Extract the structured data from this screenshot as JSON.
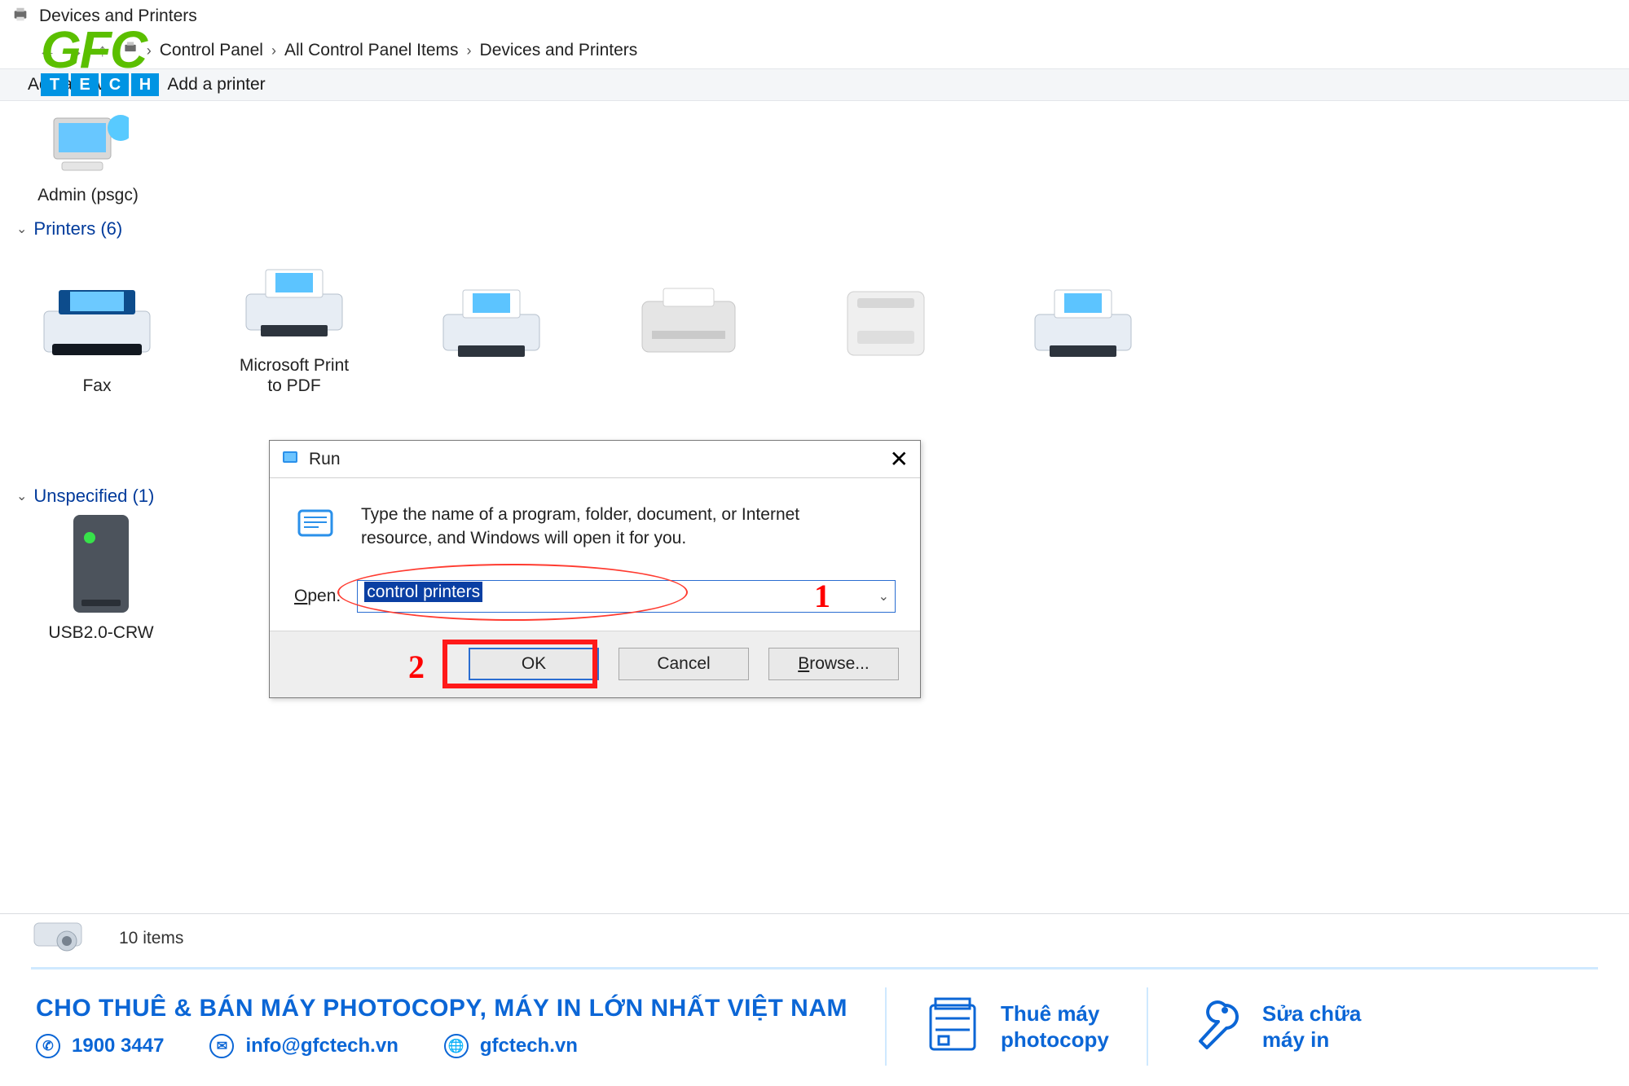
{
  "window": {
    "title": "Devices and Printers",
    "breadcrumb": [
      "Control Panel",
      "All Control Panel Items",
      "Devices and Printers"
    ],
    "toolbar": {
      "add_device": "Add a device",
      "add_printer": "Add a printer"
    },
    "device_tile_label": "Admin (psgc)",
    "printers_header": "Printers (6)",
    "printer_labels": [
      "Fax",
      "Microsoft Print to PDF"
    ],
    "unspecified_header": "Unspecified (1)",
    "unspecified_label": "USB2.0-CRW",
    "statusbar_items": "10 items"
  },
  "run": {
    "title": "Run",
    "message": "Type the name of a program, folder, document, or Internet resource, and Windows will open it for you.",
    "open_label": "Open:",
    "open_value": "control printers",
    "buttons": {
      "ok": "OK",
      "cancel": "Cancel",
      "browse": "Browse..."
    },
    "annotations": {
      "one": "1",
      "two": "2"
    }
  },
  "logo": {
    "brand": "GFC",
    "tech": [
      "T",
      "E",
      "C",
      "H"
    ]
  },
  "footer": {
    "headline": "CHO THUÊ & BÁN MÁY PHOTOCOPY, MÁY IN LỚN NHẤT VIỆT NAM",
    "phone": "1900 3447",
    "email": "info@gfctech.vn",
    "site": "gfctech.vn",
    "col1_line1": "Thuê máy",
    "col1_line2": "photocopy",
    "col2_line1": "Sửa chữa",
    "col2_line2": "máy in"
  }
}
